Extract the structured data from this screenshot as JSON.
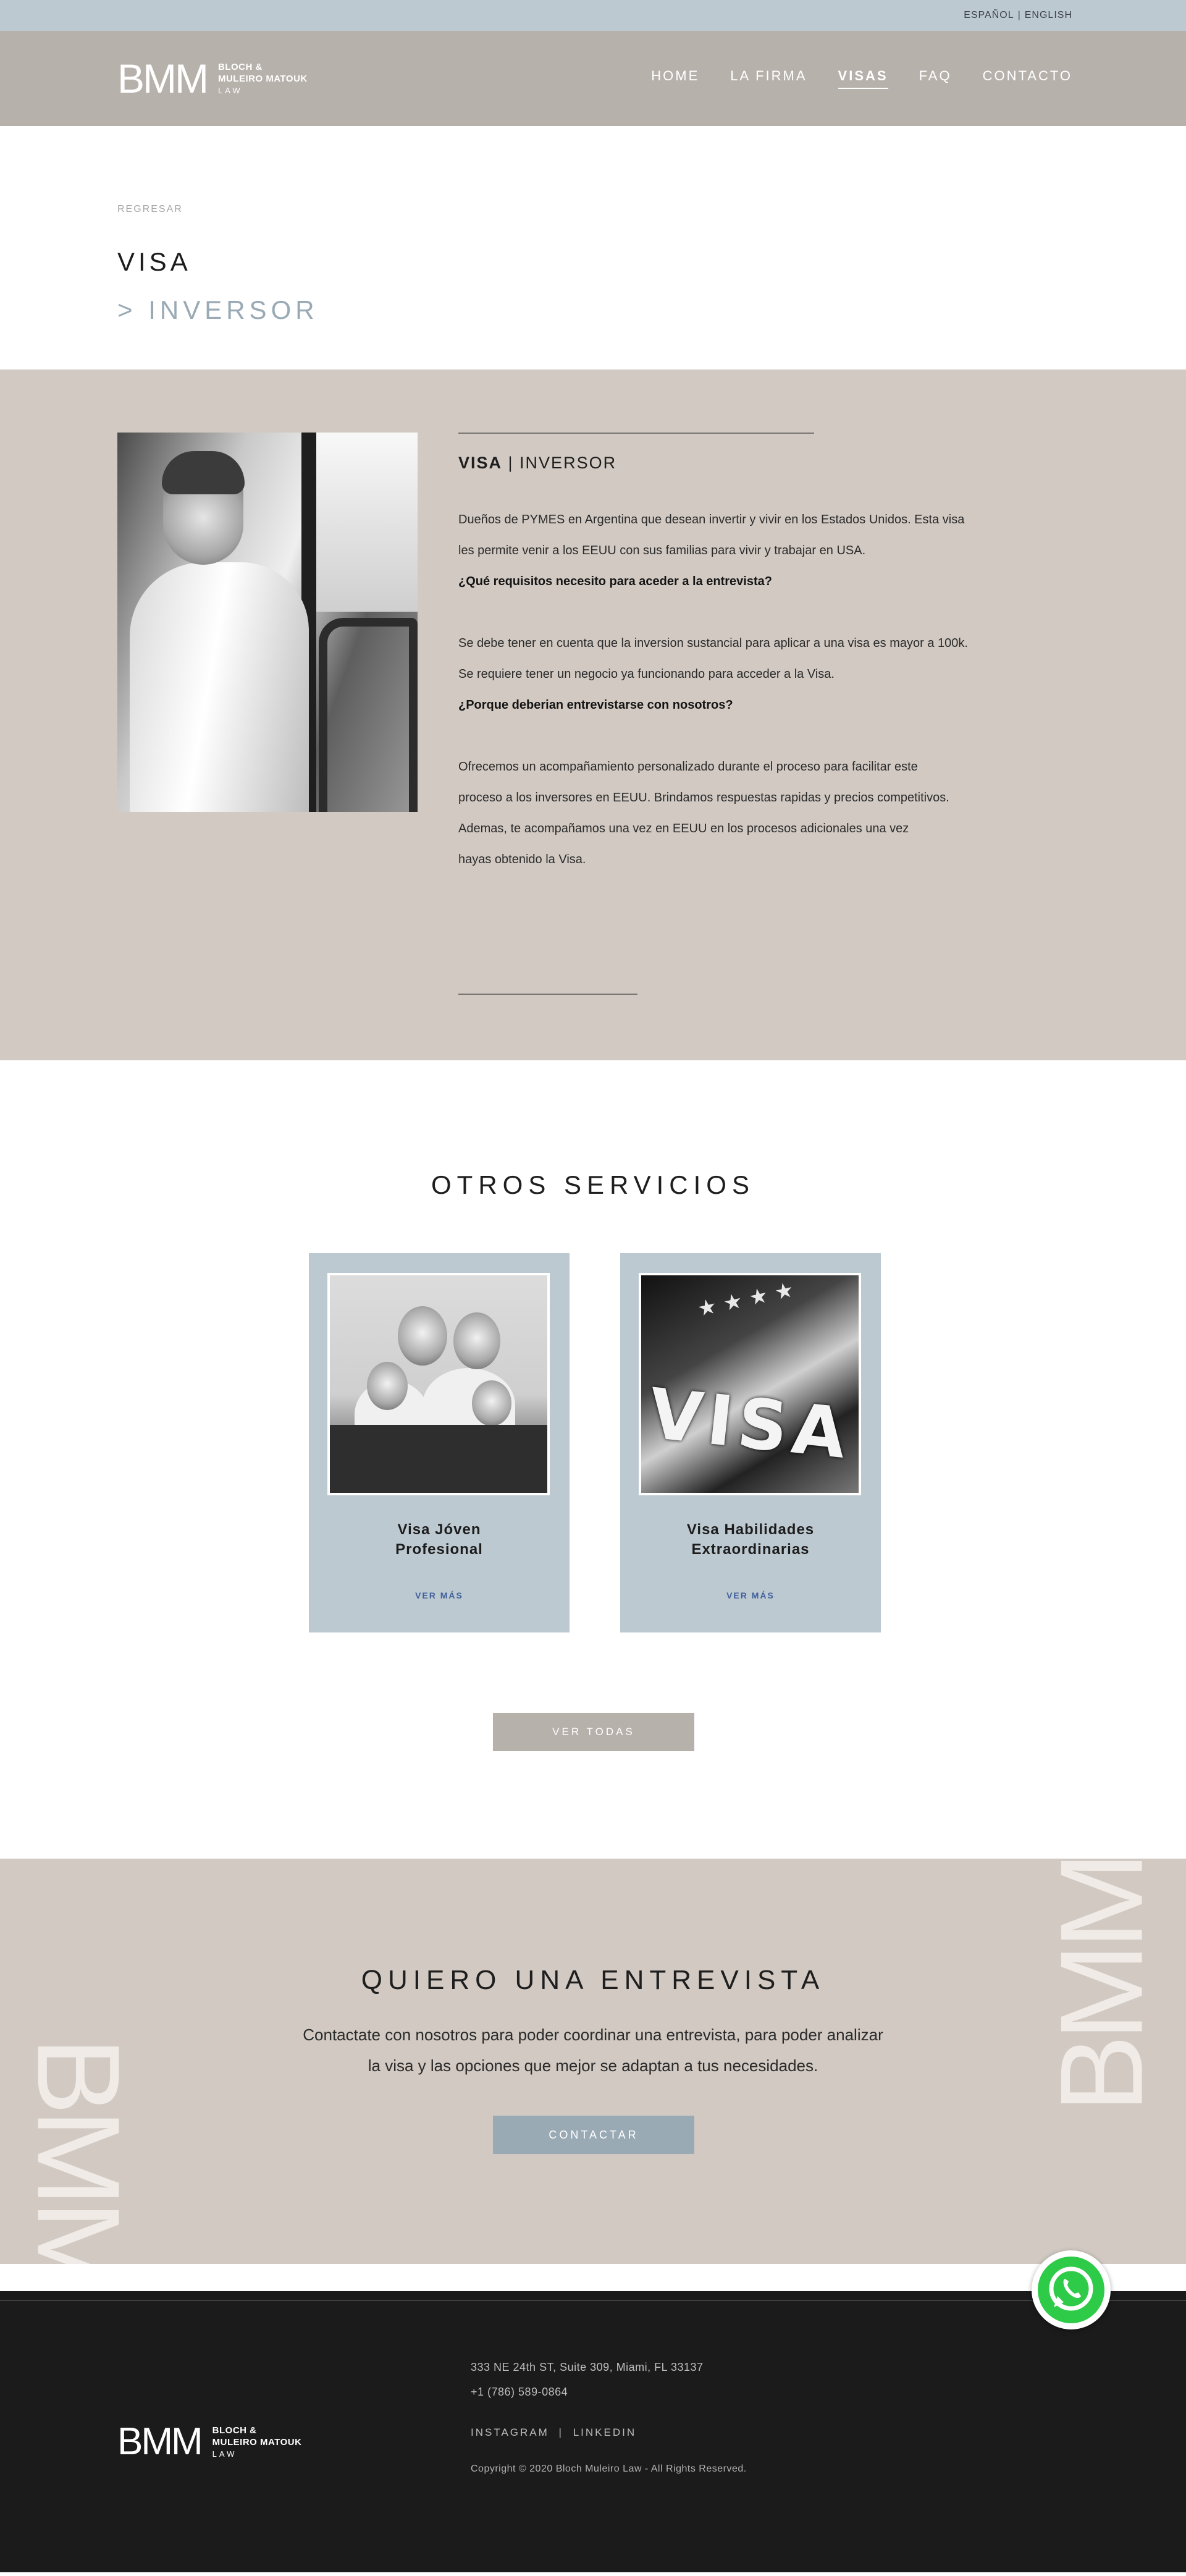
{
  "language_bar": {
    "spanish": "ESPAÑOL",
    "separator": "|",
    "english": "ENGLISH"
  },
  "header": {
    "logo_mark": "BMM",
    "logo_line1": "BLOCH &",
    "logo_line2": "MULEIRO MATOUK",
    "logo_line3": "LAW",
    "nav": [
      {
        "label": "HOME"
      },
      {
        "label": "LA FIRMA"
      },
      {
        "label": "VISAS",
        "active": true
      },
      {
        "label": "FAQ"
      },
      {
        "label": "CONTACTO"
      }
    ]
  },
  "page": {
    "back_label": "REGRESAR",
    "title": "VISA",
    "subtitle": "> INVERSOR"
  },
  "content": {
    "heading_bold": "VISA",
    "heading_rest": " | INVERSOR",
    "paragraph1_line1": "Dueños de PYMES en Argentina que desean invertir y vivir en los Estados Unidos. Esta visa",
    "paragraph1_line2": "les permite venir a los EEUU con sus familias para vivir y trabajar en USA.",
    "question1": "¿Qué requisitos necesito para aceder a la entrevista?",
    "paragraph2_line1": "Se debe tener en cuenta que la inversion sustancial para aplicar a una visa es mayor a 100k.",
    "paragraph2_line2": "Se requiere tener un negocio ya funcionando para acceder a la Visa.",
    "question2": "¿Porque deberian entrevistarse con nosotros?",
    "paragraph3_line1": "Ofrecemos un acompañamiento personalizado durante el proceso para facilitar este",
    "paragraph3_line2": "proceso a los inversores en EEUU. Brindamos respuestas rapidas y precios competitivos.",
    "paragraph3_line3": "Ademas, te acompañamos una vez en EEUU en los procesos adicionales una vez",
    "paragraph3_line4": "hayas obtenido la Visa."
  },
  "services": {
    "title": "OTROS SERVICIOS",
    "cards": [
      {
        "name_line1": "Visa Jóven",
        "name_line2": "Profesional",
        "more": "VER MÁS"
      },
      {
        "name_line1": "Visa Habilidades",
        "name_line2": "Extraordinarias",
        "more": "VER MÁS",
        "image_text": "VISA"
      }
    ],
    "view_all": "VER TODAS"
  },
  "cta": {
    "title": "QUIERO UNA ENTREVISTA",
    "desc_line1": "Contactate con nosotros para poder coordinar una entrevista, para poder analizar",
    "desc_line2": "la visa y las opciones que mejor se adaptan a tus necesidades.",
    "button": "CONTACTAR",
    "watermark": "BMM"
  },
  "footer": {
    "address": "333 NE 24th ST, Suite 309, Miami, FL 33137",
    "phone": "+1 (786) 589-0864",
    "instagram": "INSTAGRAM",
    "social_sep": "|",
    "linkedin": "LINKEDIN",
    "copyright": "Copyright © 2020 Bloch Muleiro Law - All Rights Reserved."
  },
  "colors": {
    "lang_bar": "#bdc9d1",
    "header": "#b7b1ab",
    "content_bg": "#d1c9c2",
    "accent_blue": "#99aab5",
    "footer": "#1b1b1b",
    "whatsapp": "#2dcb48"
  },
  "icons": {
    "whatsapp": "whatsapp-icon"
  }
}
